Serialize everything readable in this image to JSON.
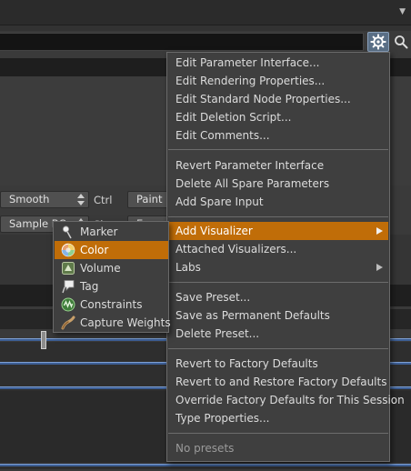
{
  "background": {
    "smooth_combo": "Smooth",
    "ctrl_label": "Ctrl",
    "paint_button": "Paint B",
    "sample_combo": "Sample BC",
    "shift_label": "Sh",
    "e_button": "E"
  },
  "menu": {
    "items": [
      {
        "label": "Edit Parameter Interface..."
      },
      {
        "label": "Edit Rendering Properties..."
      },
      {
        "label": "Edit Standard Node Properties..."
      },
      {
        "label": "Edit Deletion Script..."
      },
      {
        "label": "Edit Comments..."
      },
      {
        "label": "Revert Parameter Interface"
      },
      {
        "label": "Delete All Spare Parameters"
      },
      {
        "label": "Add Spare Input"
      },
      {
        "label": "Add Visualizer"
      },
      {
        "label": "Attached Visualizers..."
      },
      {
        "label": "Labs"
      },
      {
        "label": "Save Preset..."
      },
      {
        "label": "Save as Permanent Defaults"
      },
      {
        "label": "Delete Preset..."
      },
      {
        "label": "Revert to Factory Defaults"
      },
      {
        "label": "Revert to and Restore Factory Defaults"
      },
      {
        "label": "Override Factory Defaults for This Session"
      },
      {
        "label": "Type Properties..."
      },
      {
        "label": "No presets"
      }
    ]
  },
  "submenu": {
    "items": [
      {
        "label": "Marker",
        "icon": "marker-icon"
      },
      {
        "label": "Color",
        "icon": "color-icon"
      },
      {
        "label": "Volume",
        "icon": "volume-icon"
      },
      {
        "label": "Tag",
        "icon": "tag-icon"
      },
      {
        "label": "Constraints",
        "icon": "constraints-icon"
      },
      {
        "label": "Capture Weights",
        "icon": "capture-weights-icon"
      }
    ]
  },
  "colors": {
    "highlight": "#c06d08",
    "menu_bg": "#3f3f3f",
    "gear_button": "#5a6f86",
    "timeline_track": "#3d5f95"
  }
}
